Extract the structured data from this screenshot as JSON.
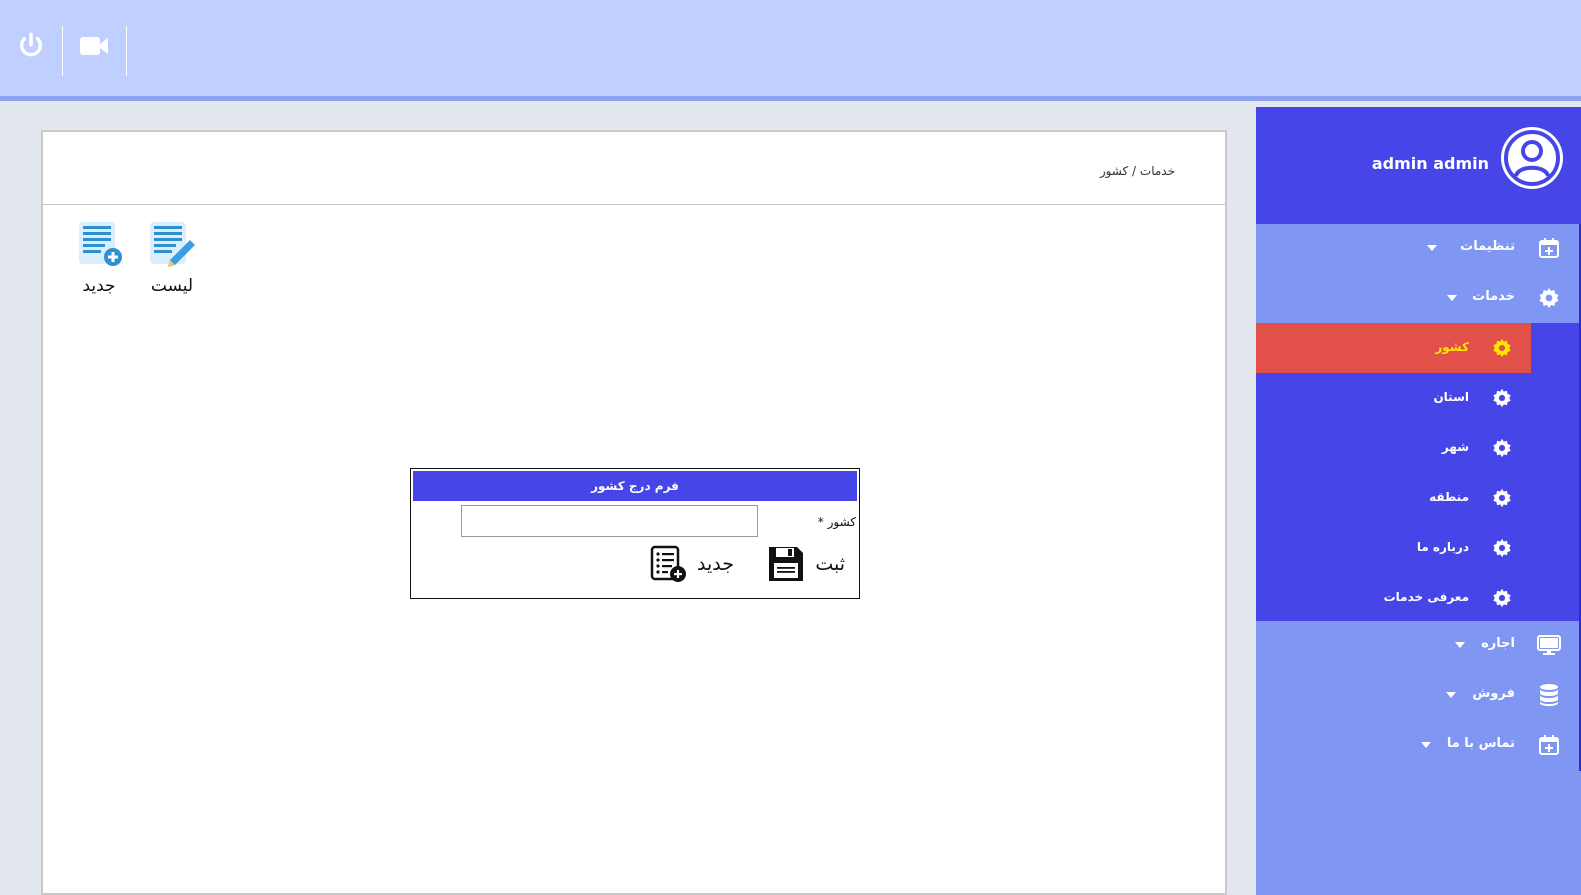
{
  "topbar": {
    "icons": [
      "power-icon",
      "video-camera-icon"
    ]
  },
  "breadcrumb": "خدمات / کشور",
  "toolbar": {
    "list_label": "لیست",
    "new_label": "جدید"
  },
  "form": {
    "title": "فرم درج کشور",
    "country_label": "کشور *",
    "country_value": "",
    "submit_label": "ثبت",
    "new_label": "جدید"
  },
  "sidebar": {
    "user_name": "admin admin",
    "menu": [
      {
        "label": "تنظیمات",
        "icon": "calendar-plus-icon"
      },
      {
        "label": "خدمات",
        "icon": "gear-icon"
      },
      {
        "label": "اجاره",
        "icon": "monitor-icon"
      },
      {
        "label": "فروش",
        "icon": "database-icon"
      },
      {
        "label": "تماس با ما",
        "icon": "calendar-plus-icon"
      }
    ],
    "submenu": [
      {
        "label": "کشور",
        "active": true
      },
      {
        "label": "استان"
      },
      {
        "label": "شهر"
      },
      {
        "label": "منطقه"
      },
      {
        "label": "درباره ما"
      },
      {
        "label": "معرفی خدمات"
      }
    ]
  },
  "colors": {
    "topbar": "#bfcfff",
    "sidebar": "#7f96f3",
    "sidebar_dark": "#4646e8",
    "active_item": "#e15049",
    "active_text": "#ffe600"
  }
}
